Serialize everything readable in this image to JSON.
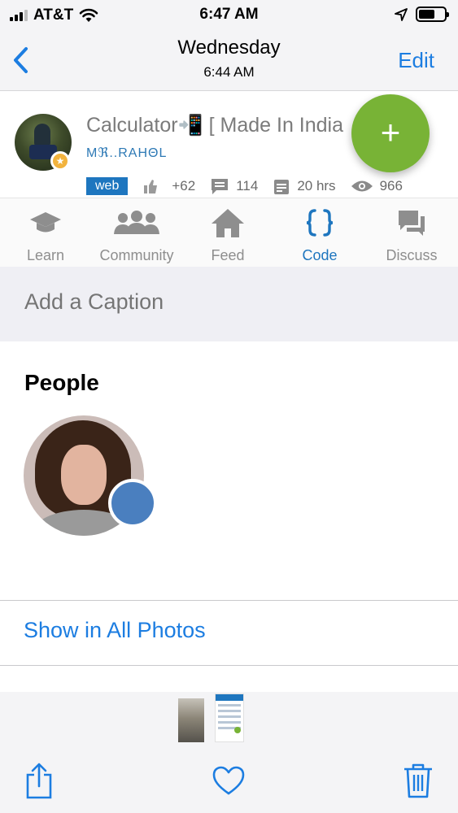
{
  "status_bar": {
    "carrier": "AT&T",
    "time": "6:47 AM"
  },
  "nav": {
    "title": "Wednesday",
    "subtitle": "6:44 AM",
    "edit_label": "Edit",
    "back_icon": "chevron-left-icon"
  },
  "post": {
    "title": "Calculator📲 [ Made In India",
    "author": "Mℜ..RAHΘL",
    "tag": "web",
    "votes": "+62",
    "comments": "114",
    "age": "20 hrs",
    "views": "966",
    "fab_label": "+"
  },
  "tabs": [
    {
      "label": "Learn",
      "icon": "graduation-cap-icon"
    },
    {
      "label": "Community",
      "icon": "community-icon"
    },
    {
      "label": "Feed",
      "icon": "home-icon"
    },
    {
      "label": "Code",
      "icon": "code-braces-icon"
    },
    {
      "label": "Discuss",
      "icon": "discuss-icon"
    }
  ],
  "caption": {
    "placeholder": "Add a Caption"
  },
  "people": {
    "title": "People"
  },
  "show_all_label": "Show in All Photos",
  "colors": {
    "accent": "#1c7de1",
    "fab": "#78b336",
    "tag": "#1e76bf"
  }
}
